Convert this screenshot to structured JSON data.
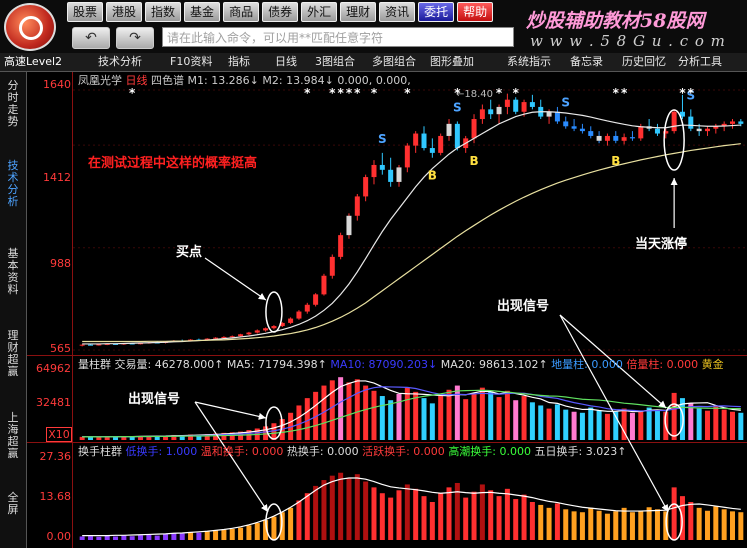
{
  "menu": [
    "股票",
    "港股",
    "指数",
    "基金",
    "商品",
    "债券",
    "外汇",
    "理财",
    "资讯",
    "委托",
    "帮助"
  ],
  "watermark": {
    "line1": "炒股辅助教材58股网",
    "line2": "w w w . 5 8 G u . c o m"
  },
  "nav": {
    "back": "↶",
    "forward": "↷"
  },
  "command_bar": {
    "placeholder": "请在此输入命令，可以用**匹配任意字符"
  },
  "toolbar": {
    "data_source": "高速Level2",
    "items": [
      "技术分析",
      "F10资料",
      "指标",
      "日线",
      "3图组合",
      "多图组合",
      "图形叠加",
      "系统指示",
      "备忘录",
      "历史回忆",
      "分析工具"
    ]
  },
  "side_tabs": [
    "分时走势",
    "技术分析",
    "基本资料",
    "理财超赢",
    "上海超赢",
    "全屏"
  ],
  "chart_title": {
    "name": "凤凰光学",
    "period": "日线",
    "indicator": "四色谱",
    "m1": "M1: 13.286↓",
    "m2": "M2: 13.984↓",
    "v1": "0.000,",
    "v2": "0.000,"
  },
  "price_axis": [
    "1640",
    "1412",
    "988",
    "565"
  ],
  "volume_axis": [
    "64962",
    "32481",
    "X10"
  ],
  "turnover_axis": [
    "27.36",
    "13.68",
    "0.00"
  ],
  "volume_info": {
    "label": "量柱群",
    "vol": "交易量: 46278.000↑",
    "ma5": "MA5: 71794.398↑",
    "ma10": "MA10: 87090.203↓",
    "ma20": "MA20: 98613.102↑",
    "dl": "地量柱: 0.000",
    "bl": "倍量柱: 0.000",
    "hj": "黄金"
  },
  "turnover_info": {
    "label": "换手柱群",
    "low": "低换手: 1.000",
    "warm": "温和换手: 0.000",
    "hot": "热换手: 0.000",
    "active": "活跃换手: 0.000",
    "high": "高潮换手: 0.000",
    "fiveday": "五日换手: 3.023↑"
  },
  "peak_label": "←18.40",
  "annotations": {
    "tested": "在测试过程中这样的概率挺高",
    "buy_point": "买点",
    "limit_up": "当天涨停",
    "signal1": "出现信号",
    "signal2": "出现信号"
  },
  "signal_labels": {
    "s": "S",
    "b": "B"
  },
  "chart_data": {
    "type": "candlestick",
    "price_ylim": [
      565,
      1640
    ],
    "price_ticks": [
      565,
      988,
      1412,
      1640
    ],
    "candles": [
      [
        585,
        588,
        580,
        587
      ],
      [
        587,
        590,
        584,
        586
      ],
      [
        586,
        589,
        583,
        588
      ],
      [
        588,
        592,
        585,
        590
      ],
      [
        590,
        592,
        587,
        589
      ],
      [
        589,
        593,
        586,
        592
      ],
      [
        592,
        595,
        589,
        590
      ],
      [
        590,
        594,
        588,
        593
      ],
      [
        593,
        598,
        591,
        596
      ],
      [
        596,
        600,
        593,
        594
      ],
      [
        594,
        601,
        592,
        600
      ],
      [
        600,
        606,
        598,
        604
      ],
      [
        604,
        608,
        600,
        602
      ],
      [
        602,
        610,
        600,
        608
      ],
      [
        608,
        612,
        604,
        606
      ],
      [
        606,
        614,
        604,
        612
      ],
      [
        612,
        618,
        609,
        616
      ],
      [
        616,
        622,
        612,
        619
      ],
      [
        619,
        625,
        615,
        622
      ],
      [
        622,
        632,
        618,
        630
      ],
      [
        630,
        640,
        626,
        637
      ],
      [
        637,
        650,
        633,
        646
      ],
      [
        646,
        658,
        641,
        655
      ],
      [
        655,
        668,
        650,
        664
      ],
      [
        664,
        680,
        660,
        677
      ],
      [
        677,
        700,
        672,
        695
      ],
      [
        695,
        730,
        690,
        724
      ],
      [
        724,
        760,
        715,
        752
      ],
      [
        752,
        800,
        745,
        795
      ],
      [
        795,
        880,
        790,
        872
      ],
      [
        872,
        960,
        860,
        950
      ],
      [
        950,
        1050,
        940,
        1040
      ],
      [
        1040,
        1130,
        1025,
        1120
      ],
      [
        1120,
        1210,
        1100,
        1200
      ],
      [
        1200,
        1290,
        1180,
        1280
      ],
      [
        1280,
        1350,
        1250,
        1330
      ],
      [
        1330,
        1380,
        1290,
        1310
      ],
      [
        1310,
        1360,
        1240,
        1260
      ],
      [
        1260,
        1330,
        1240,
        1320
      ],
      [
        1320,
        1420,
        1300,
        1410
      ],
      [
        1410,
        1470,
        1380,
        1460
      ],
      [
        1460,
        1490,
        1390,
        1400
      ],
      [
        1400,
        1440,
        1360,
        1380
      ],
      [
        1380,
        1460,
        1370,
        1450
      ],
      [
        1450,
        1520,
        1430,
        1500
      ],
      [
        1500,
        1510,
        1390,
        1400
      ],
      [
        1400,
        1450,
        1380,
        1440
      ],
      [
        1440,
        1540,
        1420,
        1520
      ],
      [
        1520,
        1580,
        1500,
        1560
      ],
      [
        1560,
        1600,
        1520,
        1540
      ],
      [
        1540,
        1580,
        1500,
        1570
      ],
      [
        1570,
        1625,
        1540,
        1600
      ],
      [
        1600,
        1610,
        1540,
        1550
      ],
      [
        1550,
        1600,
        1530,
        1590
      ],
      [
        1590,
        1620,
        1560,
        1570
      ],
      [
        1570,
        1600,
        1520,
        1530
      ],
      [
        1530,
        1560,
        1500,
        1550
      ],
      [
        1550,
        1570,
        1500,
        1510
      ],
      [
        1510,
        1530,
        1480,
        1490
      ],
      [
        1490,
        1520,
        1470,
        1480
      ],
      [
        1480,
        1500,
        1460,
        1470
      ],
      [
        1470,
        1490,
        1440,
        1450
      ],
      [
        1450,
        1470,
        1420,
        1430
      ],
      [
        1430,
        1460,
        1410,
        1450
      ],
      [
        1450,
        1470,
        1420,
        1430
      ],
      [
        1430,
        1460,
        1415,
        1445
      ],
      [
        1445,
        1470,
        1430,
        1440
      ],
      [
        1440,
        1500,
        1430,
        1490
      ],
      [
        1490,
        1520,
        1470,
        1480
      ],
      [
        1480,
        1500,
        1450,
        1460
      ],
      [
        1460,
        1480,
        1440,
        1470
      ],
      [
        1470,
        1560,
        1460,
        1550
      ],
      [
        1550,
        1620,
        1520,
        1530
      ],
      [
        1530,
        1560,
        1470,
        1480
      ],
      [
        1480,
        1500,
        1450,
        1470
      ],
      [
        1470,
        1490,
        1450,
        1480
      ],
      [
        1480,
        1500,
        1460,
        1490
      ],
      [
        1490,
        1510,
        1470,
        1500
      ],
      [
        1500,
        1520,
        1480,
        1510
      ],
      [
        1510,
        1520,
        1490,
        1500
      ]
    ],
    "ma_fast": [
      590,
      590,
      590,
      591,
      591,
      592,
      593,
      594,
      595,
      596,
      597,
      599,
      600,
      602,
      604,
      606,
      609,
      612,
      615,
      619,
      623,
      628,
      634,
      641,
      649,
      659,
      671,
      686,
      705,
      729,
      758,
      795,
      838,
      888,
      943,
      1000,
      1055,
      1105,
      1150,
      1195,
      1240,
      1280,
      1315,
      1345,
      1375,
      1400,
      1420,
      1440,
      1460,
      1480,
      1500,
      1515,
      1530,
      1540,
      1548,
      1550,
      1550,
      1548,
      1545,
      1540,
      1535,
      1528,
      1520,
      1512,
      1505,
      1498,
      1492,
      1488,
      1486,
      1484,
      1484,
      1490,
      1495,
      1494,
      1492,
      1490,
      1490,
      1491,
      1493,
      1495
    ],
    "ma_slow": [
      600,
      600,
      600,
      600,
      600,
      600,
      600,
      600,
      601,
      601,
      601,
      602,
      602,
      603,
      604,
      605,
      606,
      607,
      609,
      611,
      613,
      616,
      619,
      623,
      628,
      633,
      640,
      648,
      658,
      670,
      684,
      700,
      718,
      738,
      760,
      785,
      810,
      835,
      860,
      885,
      910,
      935,
      960,
      985,
      1010,
      1035,
      1058,
      1080,
      1102,
      1123,
      1143,
      1162,
      1180,
      1197,
      1213,
      1228,
      1242,
      1255,
      1267,
      1278,
      1289,
      1299,
      1309,
      1318,
      1327,
      1335,
      1343,
      1351,
      1358,
      1365,
      1372,
      1378,
      1384,
      1390,
      1395,
      1400,
      1405,
      1410,
      1414,
      1418
    ],
    "volume_ylim": [
      0,
      64962
    ],
    "volume_ticks": [
      32481,
      64962
    ],
    "volume": [
      3000,
      3200,
      2800,
      3500,
      3100,
      3600,
      3300,
      3800,
      4000,
      3700,
      4200,
      4800,
      4500,
      5200,
      5000,
      5600,
      6200,
      6800,
      7300,
      8000,
      9500,
      11000,
      13000,
      16000,
      20000,
      26000,
      33000,
      40000,
      46000,
      52000,
      57000,
      60000,
      55000,
      58000,
      52000,
      47000,
      42000,
      38000,
      44000,
      50000,
      46000,
      40000,
      35000,
      42000,
      48000,
      52000,
      39000,
      44000,
      50000,
      46000,
      41000,
      47000,
      38000,
      42000,
      36000,
      33000,
      30000,
      34000,
      29000,
      27000,
      26000,
      31000,
      28000,
      25000,
      27000,
      30000,
      26000,
      28000,
      31000,
      29000,
      27000,
      45000,
      40000,
      35000,
      30000,
      28000,
      32000,
      29000,
      27000,
      26000
    ],
    "turnover_ylim": [
      0,
      27.36
    ],
    "turnover_ticks": [
      0,
      13.68,
      27.36
    ],
    "turnover": [
      1.2,
      1.3,
      1.1,
      1.4,
      1.2,
      1.5,
      1.3,
      1.6,
      1.8,
      1.5,
      2.0,
      2.4,
      2.2,
      2.6,
      2.5,
      2.9,
      3.2,
      3.5,
      3.8,
      4.2,
      5.0,
      5.8,
      6.8,
      8.0,
      9.5,
      11.0,
      13.5,
      16.0,
      18.5,
      20.5,
      22.0,
      23.0,
      21.0,
      22.5,
      20.0,
      18.0,
      16.0,
      14.5,
      17.0,
      19.0,
      17.5,
      15.0,
      13.0,
      16.0,
      18.0,
      19.5,
      14.5,
      16.5,
      19.0,
      17.0,
      15.0,
      17.5,
      14.0,
      15.5,
      13.0,
      12.0,
      11.0,
      12.5,
      10.5,
      9.8,
      9.5,
      11.0,
      10.0,
      9.0,
      9.8,
      11.0,
      9.5,
      10.0,
      11.2,
      10.5,
      9.8,
      18.0,
      15.0,
      13.0,
      11.0,
      10.0,
      11.5,
      10.5,
      9.8,
      9.5
    ],
    "turnover_ma": [
      1.5,
      1.5,
      1.5,
      1.5,
      1.6,
      1.6,
      1.7,
      1.8,
      1.9,
      2.0,
      2.1,
      2.3,
      2.4,
      2.6,
      2.8,
      3.0,
      3.3,
      3.6,
      4.0,
      4.5,
      5.2,
      6.0,
      7.0,
      8.2,
      9.6,
      11.2,
      13.0,
      15.0,
      17.0,
      18.8,
      20.0,
      20.8,
      21.2,
      21.2,
      20.8,
      20.0,
      19.0,
      18.2,
      17.8,
      17.5,
      17.2,
      16.8,
      16.3,
      16.0,
      16.2,
      16.5,
      16.2,
      16.0,
      16.2,
      16.3,
      16.0,
      15.8,
      15.4,
      15.0,
      14.5,
      13.8,
      13.2,
      12.8,
      12.2,
      11.7,
      11.2,
      10.9,
      10.6,
      10.3,
      10.0,
      9.9,
      9.9,
      9.9,
      10.0,
      10.1,
      10.2,
      11.0,
      11.8,
      12.2,
      12.3,
      12.0,
      11.6,
      11.2,
      10.8,
      10.5
    ]
  }
}
